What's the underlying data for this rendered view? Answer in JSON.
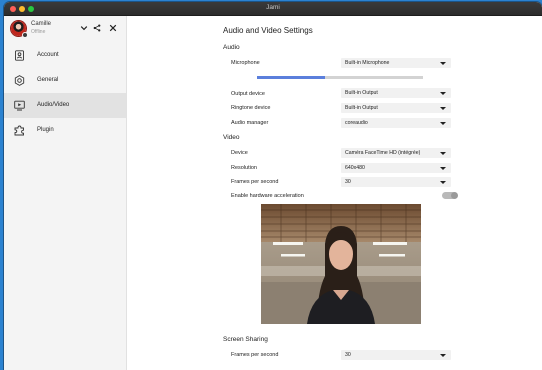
{
  "window": {
    "title": "Jami"
  },
  "profile": {
    "name": "Camille",
    "status": "Offline"
  },
  "sidebar": {
    "items": [
      {
        "label": "Account",
        "icon": "account-icon",
        "active": false
      },
      {
        "label": "General",
        "icon": "gear-icon",
        "active": false
      },
      {
        "label": "Audio/Video",
        "icon": "audio-video-icon",
        "active": true
      },
      {
        "label": "Plugin",
        "icon": "plugin-icon",
        "active": false
      }
    ]
  },
  "page": {
    "title": "Audio and Video Settings",
    "audio": {
      "heading": "Audio",
      "microphone": {
        "label": "Microphone",
        "value": "Built-in Microphone"
      },
      "input_level": 0.41,
      "output_device": {
        "label": "Output device",
        "value": "Built-in Output"
      },
      "ringtone_device": {
        "label": "Ringtone device",
        "value": "Built-in Output"
      },
      "audio_manager": {
        "label": "Audio manager",
        "value": "coreaudio"
      }
    },
    "video": {
      "heading": "Video",
      "device": {
        "label": "Device",
        "value": "Caméra FaceTime HD (intégrée)"
      },
      "resolution": {
        "label": "Resolution",
        "value": "640x480"
      },
      "fps": {
        "label": "Frames per second",
        "value": "30"
      },
      "hw_accel": {
        "label": "Enable hardware acceleration",
        "enabled": false
      }
    },
    "screen_sharing": {
      "heading": "Screen Sharing",
      "fps": {
        "label": "Frames per second",
        "value": "30"
      }
    }
  },
  "colors": {
    "accent": "#5b7fdc",
    "desktop": "#2b82d0",
    "titlebar": "#2c2c2c"
  }
}
